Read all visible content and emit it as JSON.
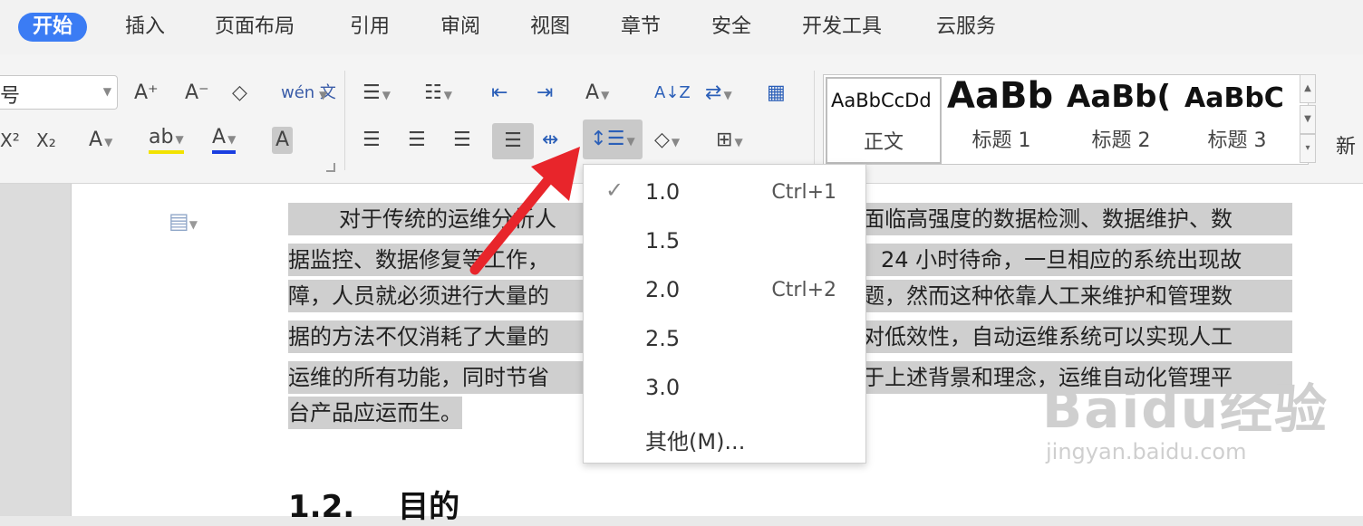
{
  "tabs": [
    "开始",
    "插入",
    "页面布局",
    "引用",
    "审阅",
    "视图",
    "章节",
    "安全",
    "开发工具",
    "云服务"
  ],
  "ribbon": {
    "font_size": "五号",
    "font_size_visible": "五号",
    "btn_grow": "A⁺",
    "btn_shrink": "A⁻",
    "btn_clear": "◇",
    "btn_pinyin": "wén 文",
    "btn_superscript": "X²",
    "btn_subscript": "X₂",
    "btn_text_effect": "A",
    "btn_highlight": "ab",
    "btn_font_color": "A",
    "btn_char_shade": "A",
    "btn_bullets": "☰",
    "btn_numbering": "☷",
    "btn_outdent": "⇤",
    "btn_indent": "⇥",
    "btn_chinese_layout": "A",
    "btn_sort": "A↓Z",
    "btn_show_hide": "⇄",
    "btn_table_frame": "▦",
    "btn_align_left": "☰",
    "btn_align_center": "☰",
    "btn_align_right": "☰",
    "btn_justify": "☰",
    "btn_distribute": "⇹",
    "btn_line_spacing": "↕☰",
    "btn_shading": "◇",
    "btn_borders": "⊞"
  },
  "styles": [
    {
      "sample": "AaBbCcDd",
      "name": "正文"
    },
    {
      "sample": "AaBb",
      "name": "标题 1"
    },
    {
      "sample": "AaBb(",
      "name": "标题 2"
    },
    {
      "sample": "AaBbC",
      "name": "标题 3"
    }
  ],
  "new_style_label": "新",
  "document": {
    "lines": [
      "对于传统的运维分析人",
      "据监控、数据修复等工作，",
      "障，人员就必须进行大量的",
      "据的方法不仅消耗了大量的",
      "运维的所有功能，同时节省",
      "台产品应运而生。"
    ],
    "lines_right": [
      "面临高强度的数据检测、数据维护、数",
      "24 小时待命，一旦相应的系统出现故",
      "题，然而这种依靠人工来维护和管理数",
      "对低效性，自动运维系统可以实现人工",
      "于上述背景和理念，运维自动化管理平",
      ""
    ],
    "heading_num": "1.2.",
    "heading_text": "目的"
  },
  "menu": {
    "items": [
      {
        "label": "1.0",
        "shortcut": "Ctrl+1",
        "checked": true
      },
      {
        "label": "1.5",
        "shortcut": "",
        "checked": false
      },
      {
        "label": "2.0",
        "shortcut": "Ctrl+2",
        "checked": false
      },
      {
        "label": "2.5",
        "shortcut": "",
        "checked": false
      },
      {
        "label": "3.0",
        "shortcut": "",
        "checked": false
      },
      {
        "label": "其他(M)...",
        "shortcut": "",
        "checked": false
      }
    ]
  },
  "watermark": {
    "brand": "Baidu经验",
    "url": "jingyan.baidu.com"
  },
  "colors": {
    "accent": "#3b7cf4",
    "arrow": "#e8252b",
    "selection": "#cfcfcf"
  }
}
